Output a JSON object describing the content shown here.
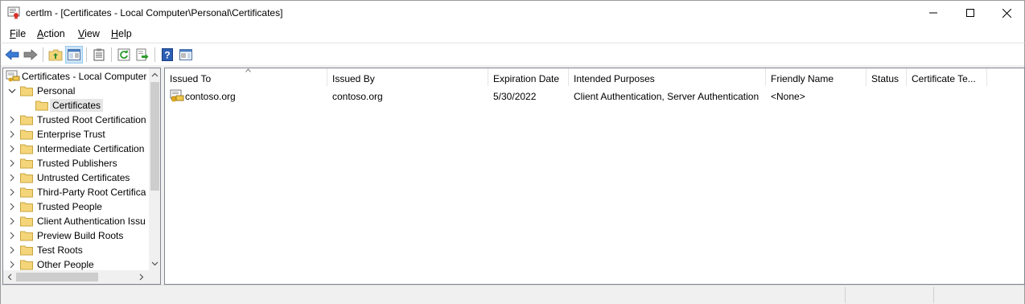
{
  "window": {
    "title": "certlm - [Certificates - Local Computer\\Personal\\Certificates]",
    "buttons": {
      "minimize": "minimize-icon",
      "maximize": "maximize-icon",
      "close": "close-icon"
    }
  },
  "menu": [
    {
      "label": "File",
      "underline": "F",
      "rest": "ile"
    },
    {
      "label": "Action",
      "underline": "A",
      "rest": "ction"
    },
    {
      "label": "View",
      "underline": "V",
      "rest": "iew"
    },
    {
      "label": "Help",
      "underline": "H",
      "rest": "elp"
    }
  ],
  "toolbar": {
    "icons": [
      "back-icon",
      "forward-icon",
      "up-folder-icon",
      "show-hide-tree-icon",
      "properties-icon",
      "refresh-icon",
      "export-list-icon",
      "help-icon",
      "show-hide-action-pane-icon"
    ]
  },
  "tree": {
    "root": "Certificates - Local Computer",
    "personal": "Personal",
    "selected": "Certificates",
    "stores": [
      "Trusted Root Certification",
      "Enterprise Trust",
      "Intermediate Certification",
      "Trusted Publishers",
      "Untrusted Certificates",
      "Third-Party Root Certifica",
      "Trusted People",
      "Client Authentication Issu",
      "Preview Build Roots",
      "Test Roots",
      "Other People"
    ]
  },
  "list": {
    "columns": [
      "Issued To",
      "Issued By",
      "Expiration Date",
      "Intended Purposes",
      "Friendly Name",
      "Status",
      "Certificate Te..."
    ],
    "sort_column": "Issued To",
    "rows": [
      {
        "issued_to": "contoso.org",
        "issued_by": "contoso.org",
        "expiration": "5/30/2022",
        "purposes": "Client Authentication, Server Authentication",
        "friendly_name": "<None>",
        "status": "",
        "template": ""
      }
    ]
  },
  "colors": {
    "selection_bg": "#e5e5e5",
    "pressed_button_bg": "#cce4f7",
    "folder_yellow": "#f5d57a",
    "back_arrow": "#3a7bd5"
  }
}
